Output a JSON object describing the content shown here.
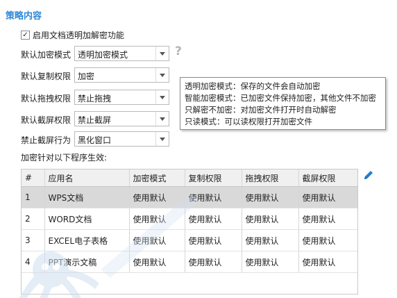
{
  "section_title": "策略内容",
  "enable": {
    "checked": "✓",
    "label": "启用文档透明加解密功能"
  },
  "fields": [
    {
      "label": "默认加密模式",
      "value": "透明加密模式"
    },
    {
      "label": "默认复制权限",
      "value": "加密"
    },
    {
      "label": "默认拖拽权限",
      "value": "禁止拖拽"
    },
    {
      "label": "默认截屏权限",
      "value": "禁止截屏"
    },
    {
      "label": "禁止截屏行为",
      "value": "黑化窗口"
    }
  ],
  "help_icon_glyph": "?",
  "tooltip_lines": [
    "透明加密模式：保存的文件会自动加密",
    "智能加密模式：已加密文件保持加密，其他文件不加密",
    "只解密不加密：对加密文件打开时自动解密",
    "只读模式：可以读权限打开加密文件"
  ],
  "list_caption": "加密针对以下程序生效:",
  "table": {
    "headers": [
      "#",
      "应用名",
      "加密模式",
      "复制权限",
      "拖拽权限",
      "截屏权限"
    ],
    "rows": [
      [
        "1",
        "WPS文档",
        "使用默认",
        "使用默认",
        "使用默认",
        "使用默认"
      ],
      [
        "2",
        "WORD文档",
        "使用默认",
        "使用默认",
        "使用默认",
        "使用默认"
      ],
      [
        "3",
        "EXCEL电子表格",
        "使用默认",
        "使用默认",
        "使用默认",
        "使用默认"
      ],
      [
        "4",
        "PPT演示文稿",
        "使用默认",
        "使用默认",
        "使用默认",
        "使用默认"
      ]
    ],
    "selected_row": 1
  },
  "colors": {
    "accent": "#2d88d6",
    "selected_row": "#d9d9d9",
    "header_bg": "#f0f0f0",
    "watermark": "#cfe0f0"
  },
  "icons": {
    "help": "question-mark-icon",
    "edit": "pencil-icon",
    "watermark": "octopus-logo-watermark"
  }
}
